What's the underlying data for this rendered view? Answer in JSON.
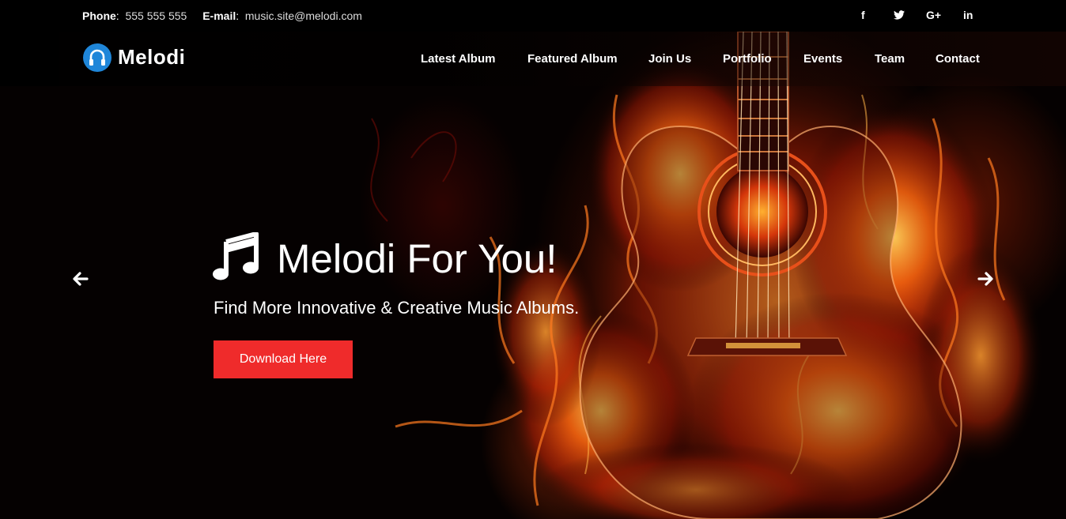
{
  "topbar": {
    "phone_label": "Phone",
    "phone_value": "555 555 555",
    "email_label": "E-mail",
    "email_value": "music.site@melodi.com",
    "social": [
      {
        "icon": "facebook-icon",
        "glyph": "f"
      },
      {
        "icon": "twitter-icon",
        "glyph": "🐦"
      },
      {
        "icon": "google-plus-icon",
        "glyph": "G+"
      },
      {
        "icon": "linkedin-icon",
        "glyph": "in"
      }
    ]
  },
  "navbar": {
    "brand": "Melodi",
    "menu": [
      "Latest Album",
      "Featured Album",
      "Join Us",
      "Portfolio",
      "Events",
      "Team",
      "Contact"
    ]
  },
  "hero": {
    "title": "Melodi For You!",
    "subtitle": "Find More Innovative & Creative Music Albums.",
    "button": "Download Here"
  },
  "colors": {
    "accent": "#ef2b2b",
    "logo": "#1f86d9"
  }
}
